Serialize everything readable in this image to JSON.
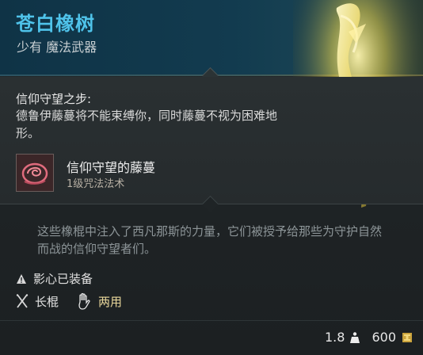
{
  "item": {
    "name": "苍白橡树",
    "rarity_type": "少有 魔法武器"
  },
  "feature": {
    "title": "信仰守望之步:",
    "description": "德鲁伊藤蔓将不能束缚你，同时藤蔓不视为困难地形。"
  },
  "spell": {
    "name": "信仰守望的藤蔓",
    "level": "1级咒法法术",
    "icon": "vine-spell-icon"
  },
  "flavor": "这些橡棍中注入了西凡那斯的力量，它们被授予给那些为守护自然而战的信仰守望者们。",
  "attunement": {
    "label": "影心已装备",
    "icon": "warning-triangle-icon"
  },
  "properties": {
    "weapon_type": "长棍",
    "weapon_icon": "crossed-staves-icon",
    "handedness": "两用",
    "hand_icon": "hand-icon"
  },
  "footer": {
    "weight": "1.8",
    "weight_icon": "weight-icon",
    "value": "600",
    "value_icon": "gold-coin-icon"
  },
  "colors": {
    "title": "#4fc3ea",
    "handedness": "#e9d79b",
    "header_bg": "#123b4f"
  }
}
